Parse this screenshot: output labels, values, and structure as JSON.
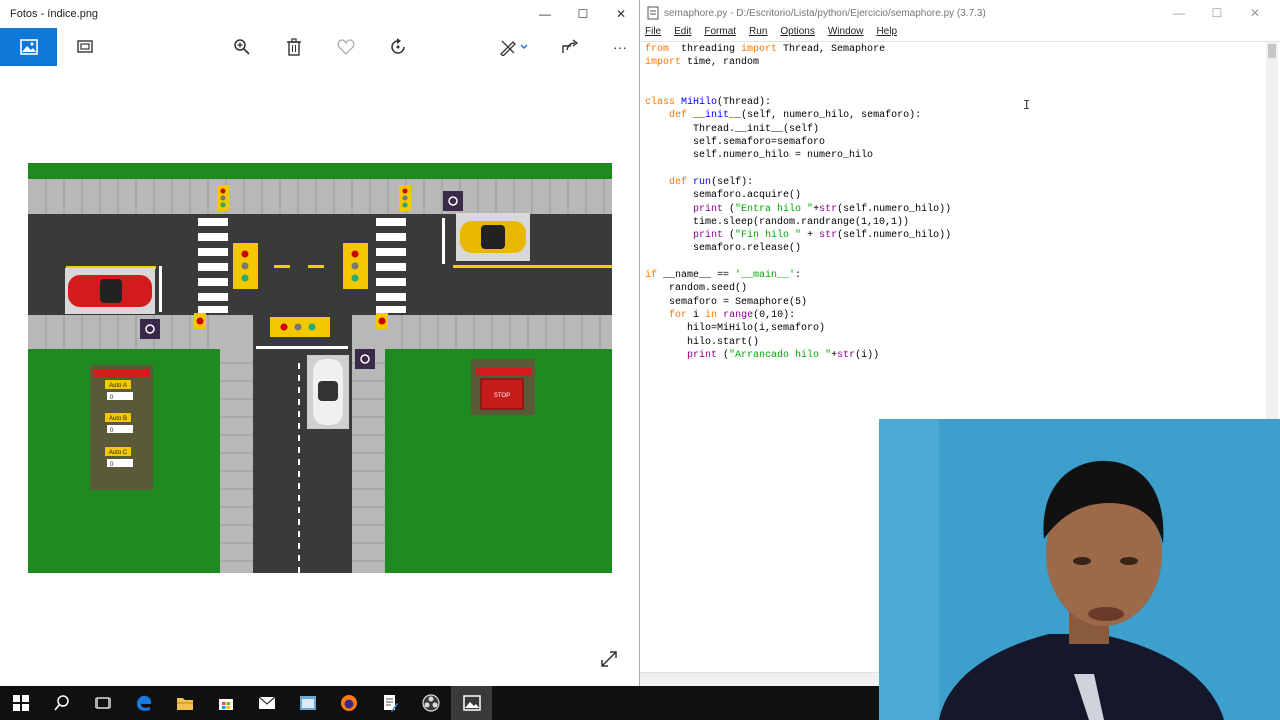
{
  "photos": {
    "title": "Fotos - índice.png",
    "minimize": "—",
    "maximize": "☐",
    "close": "✕",
    "toolbar": {
      "more": "···"
    },
    "canvas": {
      "auto_a_label": "Auto A",
      "auto_b_label": "Auto B",
      "auto_c_label": "Auto C",
      "auto_a_value": "0",
      "auto_b_value": "0",
      "auto_c_value": "0",
      "stop_label": "STOP"
    }
  },
  "idle": {
    "title": "semaphore.py - D:/Escritorio/Lista/python/Ejercicio/semaphore.py (3.7.3)",
    "minimize": "—",
    "maximize": "☐",
    "close": "✕",
    "menu": [
      "File",
      "Edit",
      "Format",
      "Run",
      "Options",
      "Window",
      "Help"
    ]
  },
  "taskbar": {
    "items": [
      "start",
      "search",
      "task-view",
      "edge",
      "file-explorer",
      "store",
      "mail",
      "app",
      "firefox",
      "idle-editor",
      "obs",
      "photos"
    ]
  }
}
